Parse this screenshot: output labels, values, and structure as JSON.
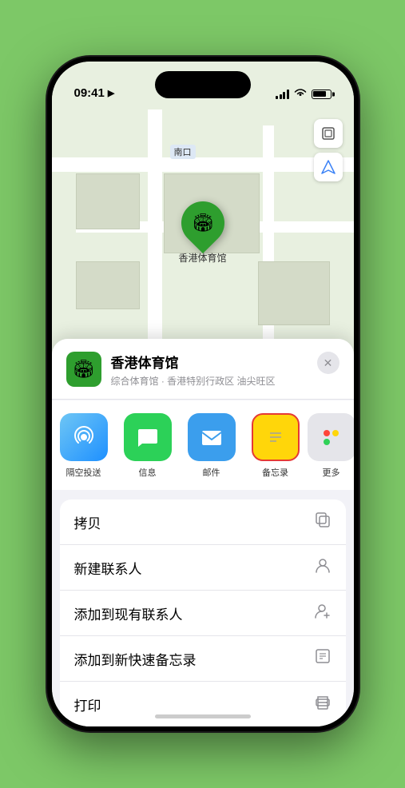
{
  "statusBar": {
    "time": "09:41",
    "locationIcon": "▶"
  },
  "mapLabel": "南口",
  "mapControls": {
    "layers": "🗺",
    "location": "⬆"
  },
  "pin": {
    "label": "香港体育馆",
    "emoji": "🏟"
  },
  "venueHeader": {
    "name": "香港体育馆",
    "subtitle": "综合体育馆 · 香港特别行政区 油尖旺区",
    "icon": "🏟",
    "closeLabel": "✕"
  },
  "shareItems": [
    {
      "id": "airdrop",
      "label": "隔空投送",
      "icon": "📡"
    },
    {
      "id": "messages",
      "label": "信息",
      "icon": "💬"
    },
    {
      "id": "mail",
      "label": "邮件",
      "icon": "✉"
    },
    {
      "id": "notes",
      "label": "备忘录",
      "icon": "≡",
      "highlighted": true
    }
  ],
  "actionItems": [
    {
      "label": "拷贝",
      "icon": "⧉"
    },
    {
      "label": "新建联系人",
      "icon": "👤"
    },
    {
      "label": "添加到现有联系人",
      "icon": "👤"
    },
    {
      "label": "添加到新快速备忘录",
      "icon": "🖊"
    },
    {
      "label": "打印",
      "icon": "🖨"
    }
  ]
}
